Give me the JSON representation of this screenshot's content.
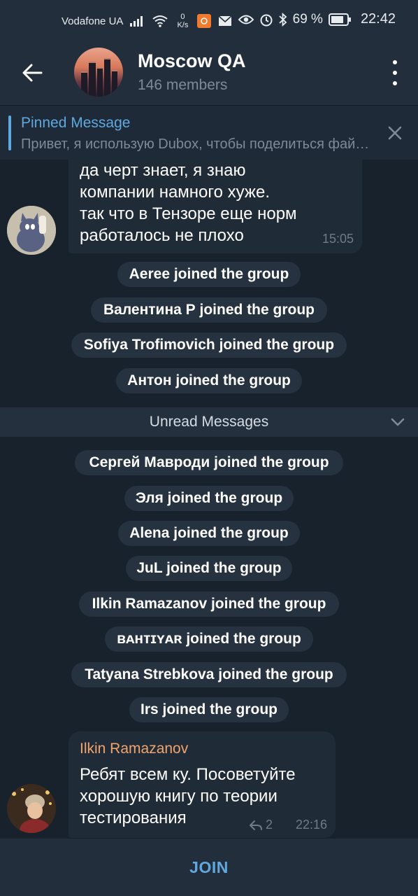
{
  "status_bar": {
    "carrier": "Vodafone UA",
    "speed_value": "0",
    "speed_unit": "K/s",
    "battery_percent": "69 %",
    "time": "22:42"
  },
  "header": {
    "title": "Moscow QA",
    "subtitle": "146 members"
  },
  "pinned": {
    "title": "Pinned Message",
    "text": "Привет, я использую Dubox, чтобы поделиться файлами"
  },
  "messages": {
    "first": {
      "lines": [
        "да черт знает, я знаю",
        "компании намного хуже.",
        "так что в Тензоре еще норм",
        "работалось не плохо"
      ],
      "time": "15:05"
    },
    "service_before": [
      "Aeree joined the group",
      "Валентина Р joined the group",
      "Sofiya Trofimovich joined the group",
      "Антон joined the group"
    ],
    "unread_label": "Unread Messages",
    "service_after": [
      "Сергей Мавроди joined the group",
      "Эля joined the group",
      "Alena joined the group",
      "JuL joined the group",
      "Ilkin Ramazanov joined the group",
      "ʙᴀʜᴛɪʏᴀʀ joined the group",
      "Tatyana Strebkova joined the group",
      "Irs joined the group"
    ],
    "last": {
      "sender": "Ilkin Ramazanov",
      "lines": [
        "Ребят всем ку. Посоветуйте",
        "хорошую книгу по теории",
        "тестирования"
      ],
      "replies": "2",
      "time": "22:16"
    }
  },
  "bottom": {
    "join_label": "JOIN"
  },
  "colors": {
    "accent": "#5fa8e0",
    "sender_name": "#f1a56b",
    "background": "#18222d",
    "bubble": "#202b38"
  }
}
